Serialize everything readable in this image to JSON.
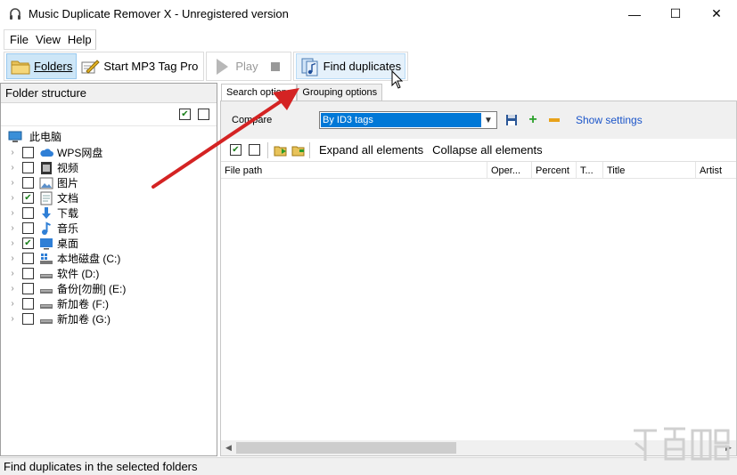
{
  "window": {
    "title": "Music Duplicate Remover X - Unregistered version",
    "minimize": "—",
    "maximize": "☐",
    "close": "✕"
  },
  "menu": {
    "items": [
      {
        "label": "File"
      },
      {
        "label": "View"
      },
      {
        "label": "Help"
      }
    ]
  },
  "toolbar": {
    "folders_label": "Folders",
    "mp3tag_label": "Start MP3 Tag Pro",
    "play_label": "Play",
    "find_label": "Find duplicates"
  },
  "folder_panel": {
    "header": "Folder structure",
    "root_label": "此电脑",
    "items": [
      {
        "label": "WPS网盘",
        "checked": false,
        "icon": "cloud-icon"
      },
      {
        "label": "视频",
        "checked": false,
        "icon": "video-icon"
      },
      {
        "label": "图片",
        "checked": false,
        "icon": "pictures-icon"
      },
      {
        "label": "文档",
        "checked": true,
        "icon": "documents-icon"
      },
      {
        "label": "下载",
        "checked": false,
        "icon": "download-icon"
      },
      {
        "label": "音乐",
        "checked": false,
        "icon": "music-icon"
      },
      {
        "label": "桌面",
        "checked": true,
        "icon": "desktop-icon"
      },
      {
        "label": "本地磁盘 (C:)",
        "checked": false,
        "icon": "system-drive-icon"
      },
      {
        "label": "软件 (D:)",
        "checked": false,
        "icon": "drive-icon"
      },
      {
        "label": "备份[勿删] (E:)",
        "checked": false,
        "icon": "drive-icon"
      },
      {
        "label": "新加卷 (F:)",
        "checked": false,
        "icon": "drive-icon"
      },
      {
        "label": "新加卷 (G:)",
        "checked": false,
        "icon": "drive-icon"
      }
    ]
  },
  "tabs": [
    {
      "label": "Search options",
      "active": true
    },
    {
      "label": "Grouping options",
      "active": false
    }
  ],
  "search_options": {
    "compare_label": "Compare",
    "compare_value": "By ID3 tags",
    "show_settings": "Show settings"
  },
  "results_toolbar": {
    "expand_label": "Expand all elements",
    "collapse_label": "Collapse all elements"
  },
  "grid": {
    "columns": [
      "File path",
      "Oper...",
      "Percent",
      "T...",
      "Title",
      "Artist"
    ]
  },
  "status": {
    "text": "Find duplicates in the selected folders"
  },
  "colors": {
    "accent": "#0078d7",
    "link": "#1b55c9",
    "annotation_arrow": "#d42323"
  }
}
